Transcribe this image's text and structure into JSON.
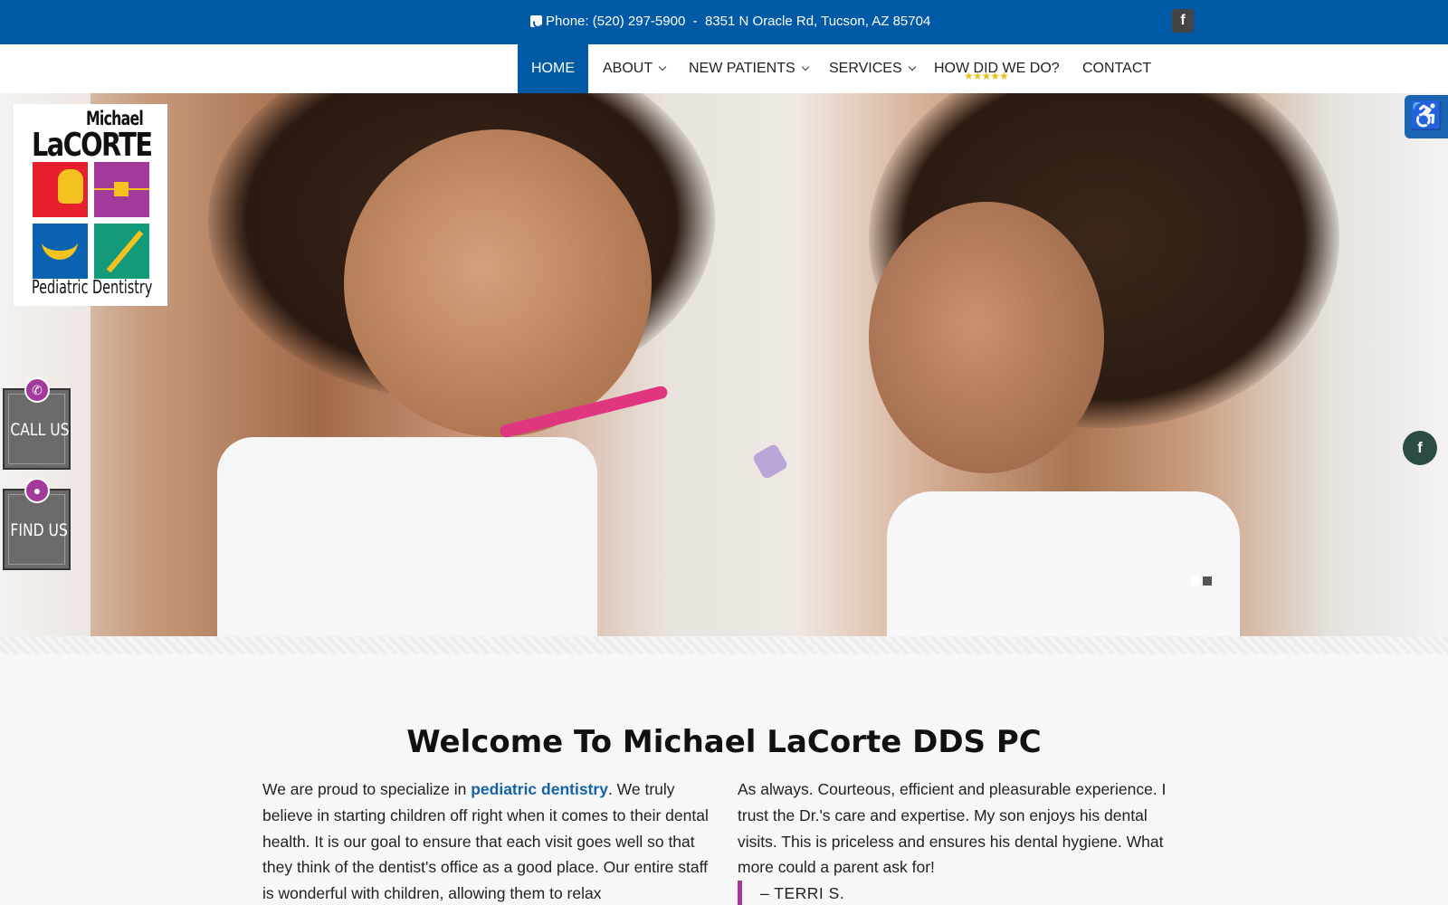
{
  "topbar": {
    "phone_label": "Phone:",
    "phone_number": "(520) 297-5900",
    "separator": "-",
    "address": "8351 N Oracle Rd, Tucson, AZ 85704",
    "facebook_glyph": "f"
  },
  "nav": {
    "items": [
      {
        "label": "HOME",
        "active": true,
        "dropdown": false
      },
      {
        "label": "ABOUT",
        "active": false,
        "dropdown": true
      },
      {
        "label": "NEW PATIENTS",
        "active": false,
        "dropdown": true
      },
      {
        "label": "SERVICES",
        "active": false,
        "dropdown": true
      },
      {
        "label": "HOW DID WE DO?",
        "active": false,
        "dropdown": false
      },
      {
        "label": "CONTACT",
        "active": false,
        "dropdown": false
      }
    ],
    "rating_stars": "★★★★★"
  },
  "logo": {
    "line1": "Michael",
    "line2": "LaCORTE",
    "tagline": "Pediatric Dentistry"
  },
  "side_buttons": {
    "call": "CALL US",
    "find": "FIND US",
    "call_icon": "phone-icon",
    "find_icon": "map-pin-icon"
  },
  "accessibility": {
    "icon": "wheelchair-icon",
    "glyph": "♿"
  },
  "social": {
    "facebook_glyph": "f"
  },
  "slider": {
    "slide_count": 2,
    "active_index": 0
  },
  "content": {
    "title": "Welcome To Michael LaCorte DDS PC",
    "left_intro": "We are proud to specialize in ",
    "left_link": "pediatric dentistry",
    "left_rest": ". We truly believe in starting children off right when it comes to their dental health. It is our goal to ensure that each visit goes well so that they think of the dentist's office as a good place. Our entire staff is wonderful with children, allowing them to relax",
    "right_quote": "As always. Courteous, efficient and pleasurable experience. I trust the Dr.'s care and expertise. My son enjoys his dental visits. This is priceless and ensures his dental hygiene. What more could a parent ask for!",
    "right_author": "– TERRI S."
  },
  "colors": {
    "brand_blue": "#005aa5",
    "accent_purple": "#a23a9b",
    "link_blue": "#1463a8"
  }
}
